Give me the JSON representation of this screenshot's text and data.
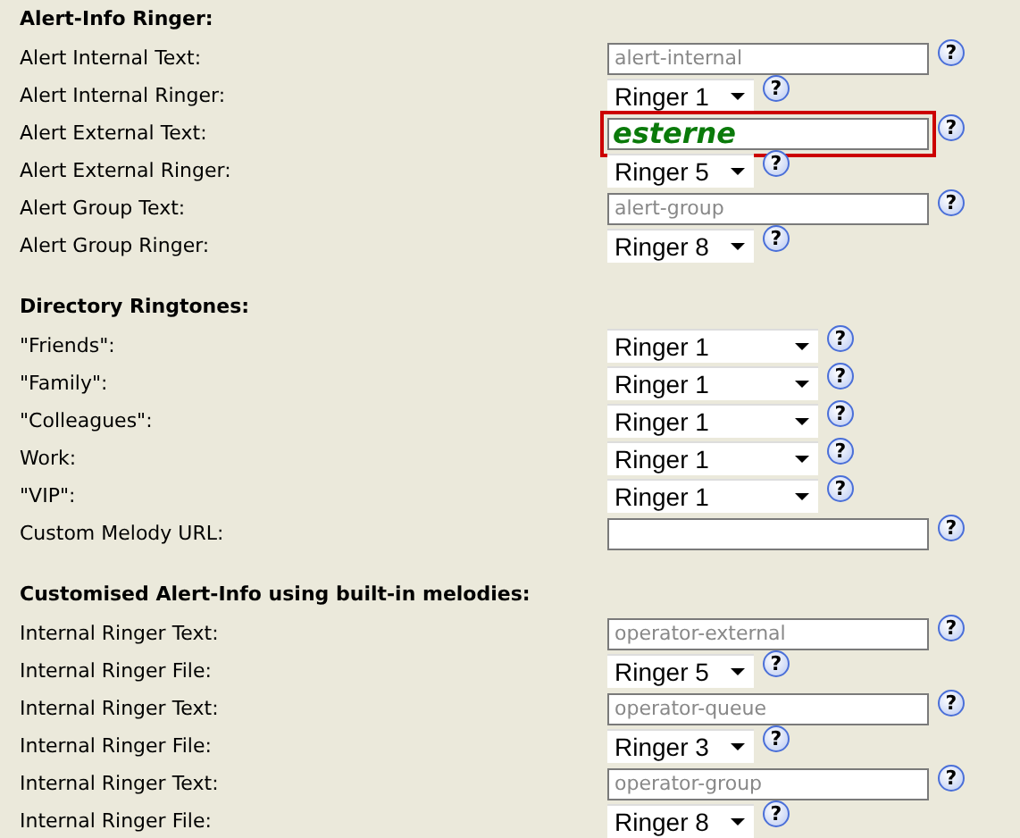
{
  "sections": [
    {
      "title": "Alert-Info Ringer:",
      "rows": [
        {
          "label": "Alert Internal Text:",
          "kind": "text",
          "placeholder": "alert-internal",
          "highlighted": false,
          "help": "?"
        },
        {
          "label": "Alert Internal Ringer:",
          "kind": "select",
          "value": "Ringer 1",
          "help": "?"
        },
        {
          "label": "Alert External Text:",
          "kind": "text",
          "value": "esterne",
          "highlighted": true,
          "help": "?"
        },
        {
          "label": "Alert External Ringer:",
          "kind": "select",
          "value": "Ringer 5",
          "help": "?"
        },
        {
          "label": "Alert Group Text:",
          "kind": "text",
          "placeholder": "alert-group",
          "highlighted": false,
          "help": "?"
        },
        {
          "label": "Alert Group Ringer:",
          "kind": "select",
          "value": "Ringer 8",
          "help": "?"
        }
      ]
    },
    {
      "title": "Directory Ringtones:",
      "rows": [
        {
          "label": "\"Friends\":",
          "kind": "wide-select",
          "value": "Ringer 1",
          "help": "?"
        },
        {
          "label": "\"Family\":",
          "kind": "wide-select",
          "value": "Ringer 1",
          "help": "?"
        },
        {
          "label": "\"Colleagues\":",
          "kind": "wide-select",
          "value": "Ringer 1",
          "help": "?"
        },
        {
          "label": "Work:",
          "kind": "wide-select",
          "value": "Ringer 1",
          "help": "?"
        },
        {
          "label": "\"VIP\":",
          "kind": "wide-select",
          "value": "Ringer 1",
          "help": "?"
        },
        {
          "label": "Custom Melody URL:",
          "kind": "text",
          "help": "?"
        }
      ]
    },
    {
      "title": "Customised Alert-Info using built-in melodies:",
      "rows": [
        {
          "label": "Internal Ringer Text:",
          "kind": "text",
          "placeholder": "operator-external",
          "highlighted": false,
          "help": "?"
        },
        {
          "label": "Internal Ringer File:",
          "kind": "select",
          "value": "Ringer 5",
          "help": "?"
        },
        {
          "label": "Internal Ringer Text:",
          "kind": "text",
          "placeholder": "operator-queue",
          "highlighted": false,
          "help": "?"
        },
        {
          "label": "Internal Ringer File:",
          "kind": "select",
          "value": "Ringer 3",
          "help": "?"
        },
        {
          "label": "Internal Ringer Text:",
          "kind": "text",
          "placeholder": "operator-group",
          "highlighted": false,
          "help": "?"
        },
        {
          "label": "Internal Ringer File:",
          "kind": "select",
          "value": "Ringer 8",
          "help": "?"
        }
      ]
    }
  ]
}
